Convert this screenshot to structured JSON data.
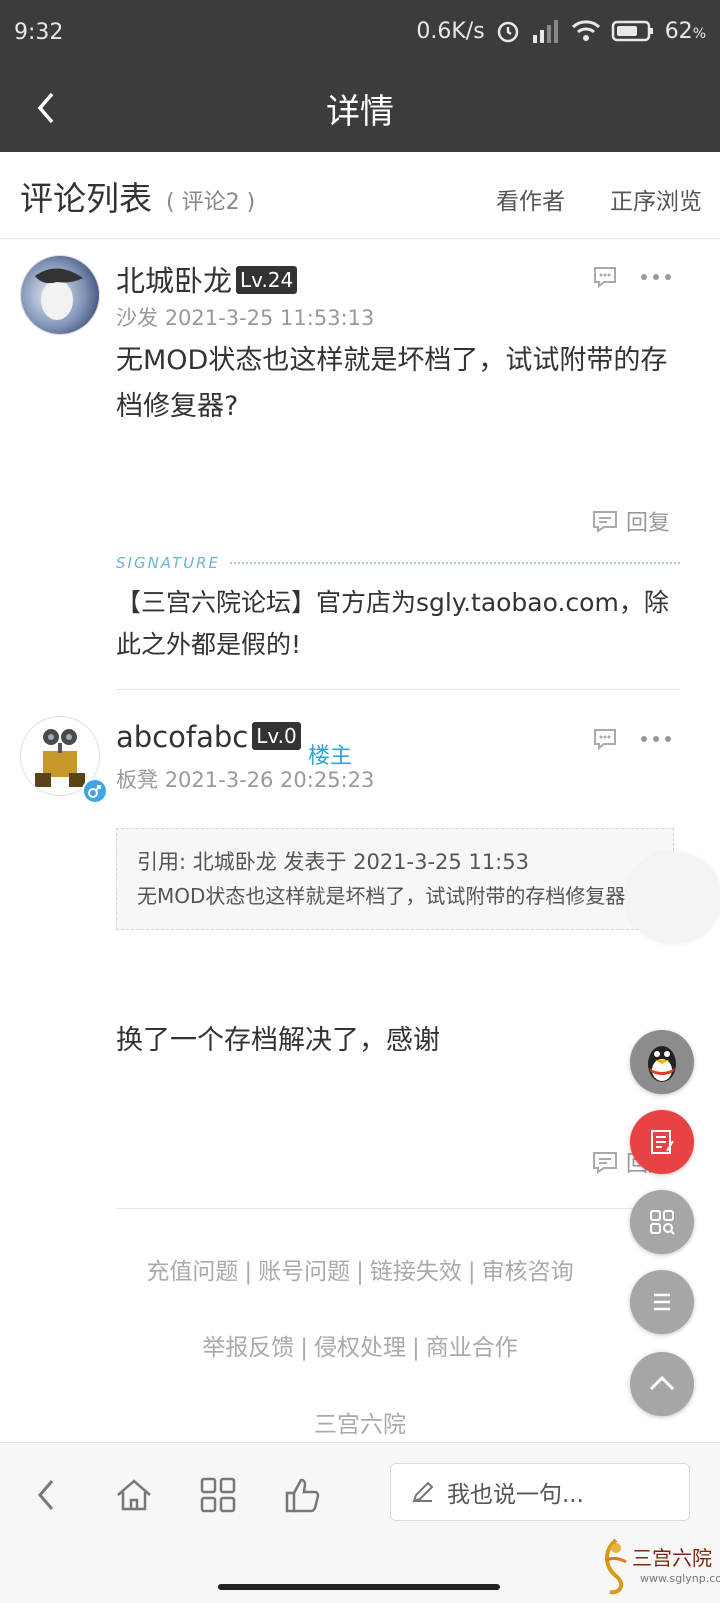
{
  "status": {
    "time": "9:32",
    "speed": "0.6K/s",
    "battery": "62"
  },
  "nav": {
    "title": "详情"
  },
  "list": {
    "title": "评论列表",
    "count": "( 评论2 )",
    "author_only": "看作者",
    "order": "正序浏览"
  },
  "posts": [
    {
      "user": "北城卧龙",
      "level": "Lv.24",
      "floor": "沙发",
      "time": "2021-3-25 11:53:13",
      "text": "无MOD状态也这样就是坏档了，试试附带的存档修复器?",
      "reply": "回复",
      "signature_label": "SIGNATURE",
      "signature": "【三宫六院论坛】官方店为sgly.taobao.com，除此之外都是假的!"
    },
    {
      "user": "abcofabc",
      "level": "Lv.0",
      "badge": "楼主",
      "floor": "板凳",
      "time": "2021-3-26 20:25:23",
      "quote_header": "引用: 北城卧龙 发表于 2021-3-25 11:53",
      "quote_text": "无MOD状态也这样就是坏档了，试试附带的存档修复器?",
      "text": "换了一个存档解决了，感谢",
      "reply": "回复"
    }
  ],
  "footer": {
    "row1": [
      "充值问题",
      "账号问题",
      "链接失效",
      "审核咨询"
    ],
    "row2": [
      "举报反馈",
      "侵权处理",
      "商业合作"
    ],
    "site": "三宫六院"
  },
  "toolbar": {
    "input_placeholder": "我也说一句..."
  },
  "watermark": {
    "name": "三宫六院",
    "url": "www.sglynp.com"
  },
  "colors": {
    "bar": "#3c3c3c",
    "accent": "#2aa6d8",
    "fab_red": "#e84343"
  }
}
